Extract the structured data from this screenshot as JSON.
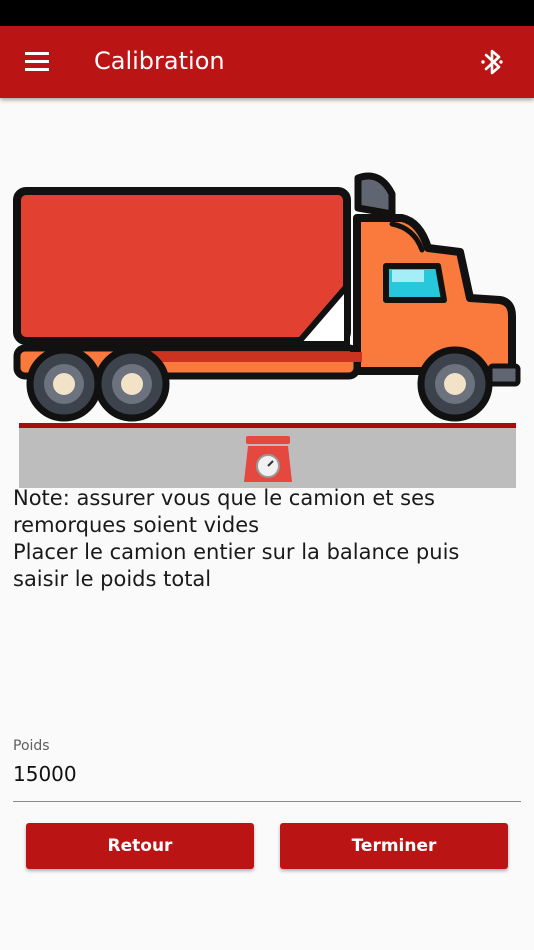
{
  "app_bar": {
    "title": "Calibration",
    "menu_icon": "menu-icon",
    "bluetooth_icon": "bluetooth-icon"
  },
  "illustration": {
    "truck_icon": "truck-icon",
    "scale_icon": "scale-icon",
    "colors": {
      "trailer": "#e24132",
      "cab": "#f97a3c",
      "outline": "#111111",
      "window": "#27c7dc",
      "platform": "#bdbdbd",
      "platform_edge": "#a30f0f"
    }
  },
  "note": {
    "lines": [
      "Note: assurer vous que le camion et ses",
      "remorques soient vides",
      "Placer le camion entier sur la balance puis",
      "saisir le poids total"
    ]
  },
  "form": {
    "weight_label": "Poids",
    "weight_value": "15000"
  },
  "buttons": {
    "back_label": "Retour",
    "finish_label": "Terminer"
  },
  "colors": {
    "primary": "#bb1414",
    "background": "#fafafa"
  }
}
